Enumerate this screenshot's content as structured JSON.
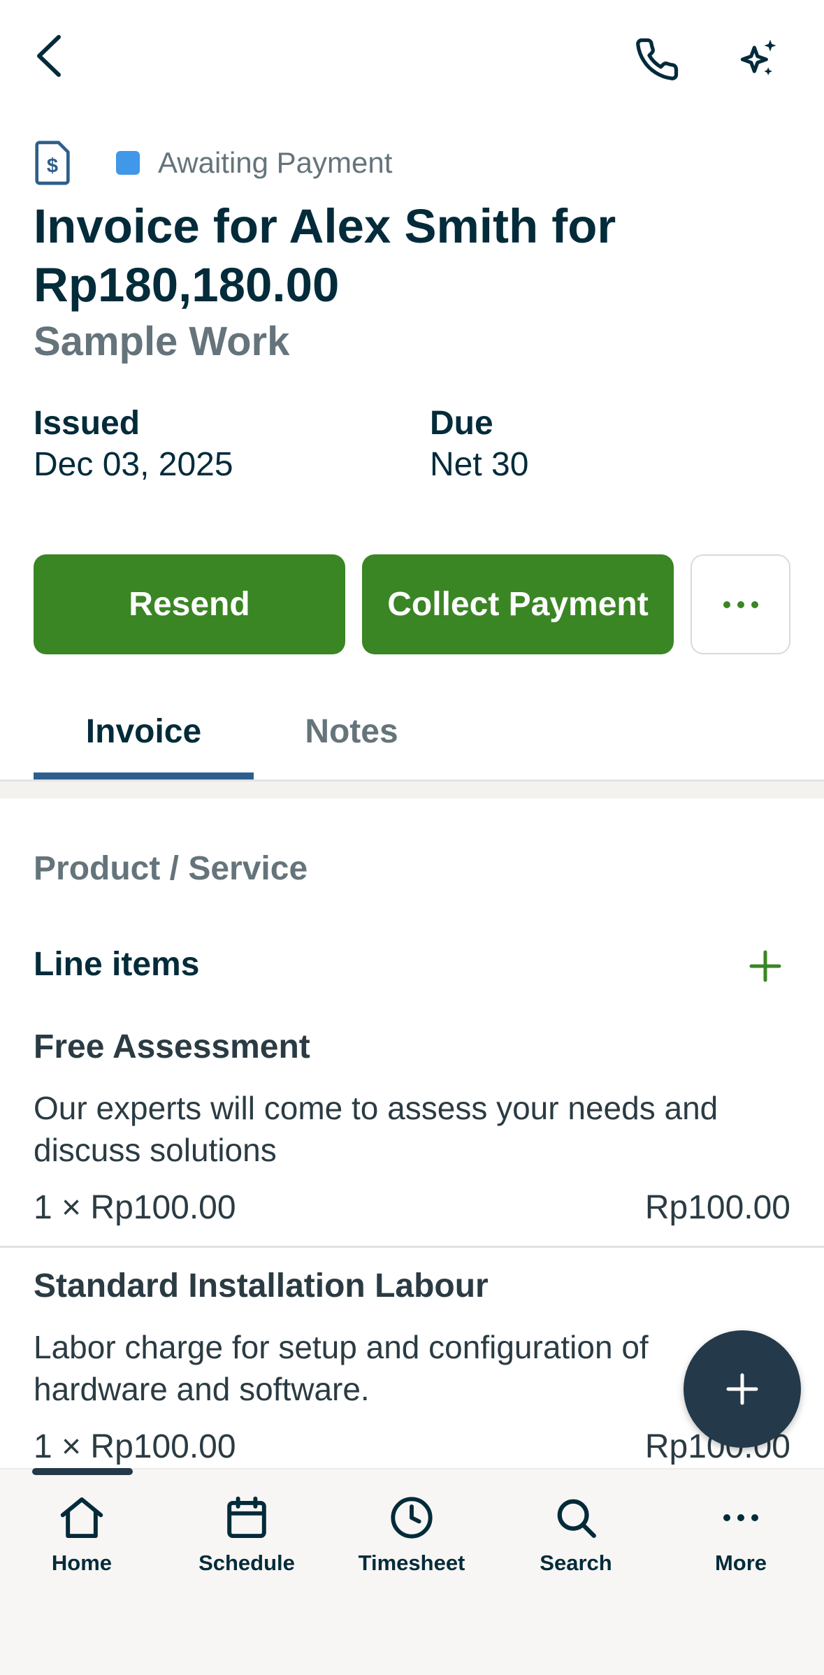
{
  "header": {
    "status": "Awaiting Payment",
    "status_color": "#4197e8",
    "title": "Invoice for Alex Smith for Rp180,180.00",
    "subtitle": "Sample Work",
    "icons": [
      "back-arrow-icon",
      "phone-icon",
      "sparkle-icon",
      "invoice-document-icon"
    ]
  },
  "meta": {
    "issued_label": "Issued",
    "issued_value": "Dec 03, 2025",
    "due_label": "Due",
    "due_value": "Net 30"
  },
  "actions": {
    "resend": "Resend",
    "collect_payment": "Collect Payment",
    "more_icon": "ellipsis-icon",
    "primary_color": "#3a8524"
  },
  "tabs": {
    "invoice": "Invoice",
    "notes": "Notes",
    "active": "Invoice"
  },
  "section": {
    "label": "Product / Service",
    "line_items_title": "Line items",
    "items": [
      {
        "name": "Free Assessment",
        "description": "Our experts will come to assess your needs and discuss solutions",
        "quantity": "1 × Rp100.00",
        "total": "Rp100.00"
      },
      {
        "name": "Standard Installation Labour",
        "description": "Labor charge for setup and configuration of hardware and software.",
        "quantity": "1 × Rp100.00",
        "total": "Rp100.00"
      }
    ]
  },
  "nav": {
    "items": [
      {
        "label": "Home",
        "icon": "home-icon"
      },
      {
        "label": "Schedule",
        "icon": "calendar-icon"
      },
      {
        "label": "Timesheet",
        "icon": "clock-icon"
      },
      {
        "label": "Search",
        "icon": "search-icon"
      },
      {
        "label": "More",
        "icon": "ellipsis-icon"
      }
    ]
  }
}
